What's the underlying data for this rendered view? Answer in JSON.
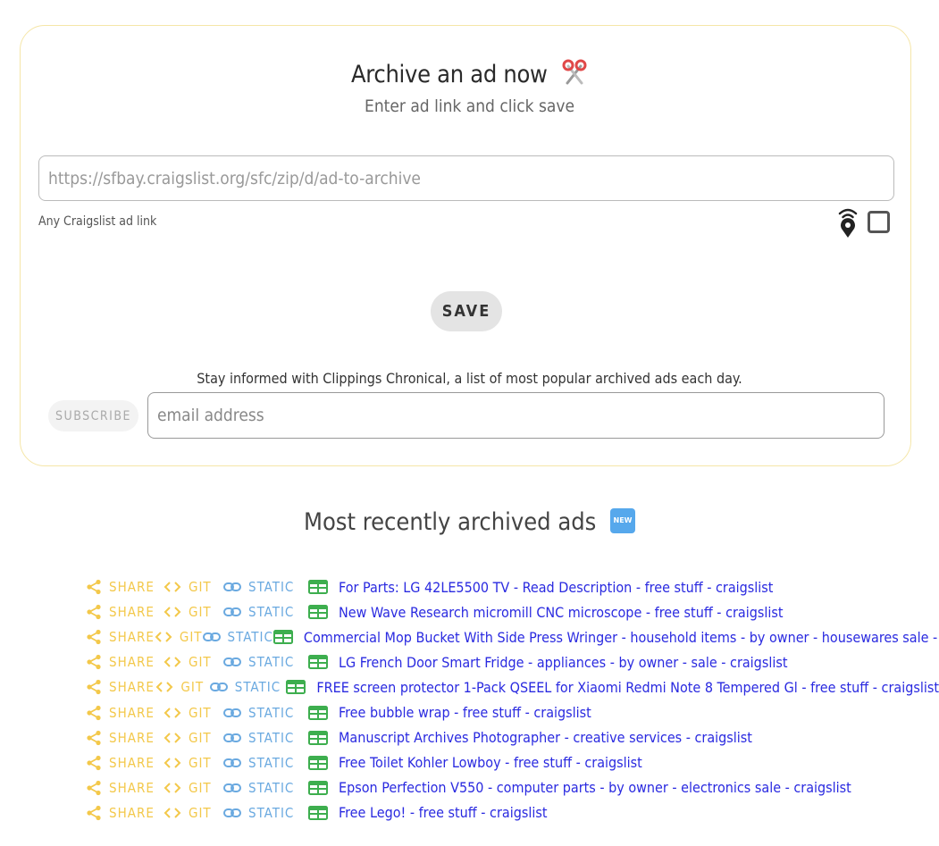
{
  "hero": {
    "title": "Archive an ad now",
    "subtitle": "Enter ad link and click save"
  },
  "url_field": {
    "placeholder": "https://sfbay.craigslist.org/sfc/zip/d/ad-to-archive",
    "value": "",
    "hint": "Any Craigslist ad link"
  },
  "save_label": "SAVE",
  "newsletter": {
    "text": "Stay informed with Clippings Chronical, a list of most popular archived ads each day.",
    "subscribe_label": "SUBSCRIBE",
    "email_placeholder": "email address"
  },
  "recent": {
    "title": "Most recently archived ads",
    "badge": "NEW",
    "action_labels": {
      "share": "SHARE",
      "git": "GIT",
      "static": "STATIC"
    },
    "ads": [
      "For Parts: LG 42LE5500 TV - Read Description - free stuff - craigslist",
      "New Wave Research micromill CNC microscope - free stuff - craigslist",
      "Commercial Mop Bucket With Side Press Wringer - household items - by owner - housewares sale - craigslist",
      "LG French Door Smart Fridge - appliances - by owner - sale - craigslist",
      "FREE screen protector 1-Pack QSEEL for Xiaomi Redmi Note 8 Tempered Gl - free stuff - craigslist",
      "Free bubble wrap - free stuff - craigslist",
      "Manuscript Archives Photographer - creative services - craigslist",
      "Free Toilet Kohler Lowboy - free stuff - craigslist",
      "Epson Perfection V550 - computer parts - by owner - electronics sale - craigslist",
      "Free Lego! - free stuff - craigslist"
    ]
  },
  "colors": {
    "share_git": "#f3c84a",
    "static": "#6aa9e0",
    "link": "#2a2ae0",
    "card_border": "#f5e6a8",
    "badge": "#56a8ec",
    "table_icon": "#3dae4e"
  },
  "icons": [
    "scissors-icon",
    "location-signal-icon",
    "new-badge",
    "share-icon",
    "code-icon",
    "link-icon",
    "table-icon"
  ]
}
